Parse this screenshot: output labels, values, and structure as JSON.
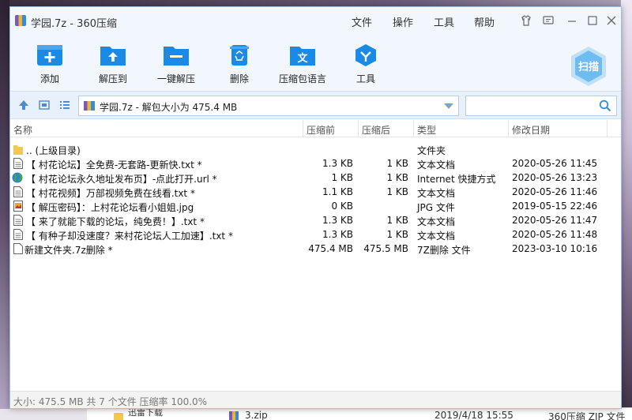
{
  "window": {
    "title": "学园.7z - 360压缩",
    "menus": [
      "文件",
      "操作",
      "工具",
      "帮助"
    ]
  },
  "toolbar": {
    "add": "添加",
    "extract_to": "解压到",
    "one_click_extract": "一键解压",
    "delete": "删除",
    "language": "压缩包语言",
    "tools": "工具",
    "scan": "扫描"
  },
  "address": {
    "path": "学园.7z - 解包大小为 475.4 MB",
    "search_value": ""
  },
  "columns": {
    "name": "名称",
    "before": "压缩前",
    "after": "压缩后",
    "type": "类型",
    "modified": "修改日期"
  },
  "files": [
    {
      "icon": "folder-icon",
      "name": ".. (上级目录)",
      "before": "",
      "after": "",
      "type": "文件夹",
      "modified": ""
    },
    {
      "icon": "text-file-icon",
      "name": "【 村花论坛】全免费-无套路-更新快.txt *",
      "before": "1.3 KB",
      "after": "1 KB",
      "type": "文本文档",
      "modified": "2020-05-26 11:45"
    },
    {
      "icon": "internet-shortcut-icon",
      "name": "【 村花论坛永久地址发布页】-点此打开.url *",
      "before": "1 KB",
      "after": "1 KB",
      "type": "Internet 快捷方式",
      "modified": "2020-05-26 13:23"
    },
    {
      "icon": "text-file-icon",
      "name": "【 村花视频】万部视频免费在线看.txt *",
      "before": "1.1 KB",
      "after": "1 KB",
      "type": "文本文档",
      "modified": "2020-05-26 11:46"
    },
    {
      "icon": "image-file-icon",
      "name": "【 解压密码】：上村花论坛看小姐姐.jpg",
      "before": "0 KB",
      "after": "",
      "type": "JPG 文件",
      "modified": "2019-05-15 22:46"
    },
    {
      "icon": "text-file-icon",
      "name": "【 来了就能下载的论坛，纯免费！】.txt *",
      "before": "1.3 KB",
      "after": "1 KB",
      "type": "文本文档",
      "modified": "2020-05-26 11:47"
    },
    {
      "icon": "text-file-icon",
      "name": "【 有种子却没速度？来村花论坛人工加速】.txt *",
      "before": "1.3 KB",
      "after": "1 KB",
      "type": "文本文档",
      "modified": "2020-05-26 11:48"
    },
    {
      "icon": "blank-file-icon",
      "name": "新建文件夹.7z删除 *",
      "before": "475.4 MB",
      "after": "475.5 MB",
      "type": "7Z删除 文件",
      "modified": "2023-03-10 10:16"
    }
  ],
  "status": {
    "text": "大小: 475.5 MB 共 7 个文件 压缩率 100.0%"
  },
  "background": {
    "folder_name": "迅雷下载",
    "zip_name": "3.zip",
    "zip_date": "2019/4/18 15:55",
    "zip_type": "360压缩 ZIP 文件"
  },
  "colors": {
    "accent": "#1a8ae6",
    "titlebar_bg": "#f1f7fd",
    "folder": "#f4c84d"
  }
}
